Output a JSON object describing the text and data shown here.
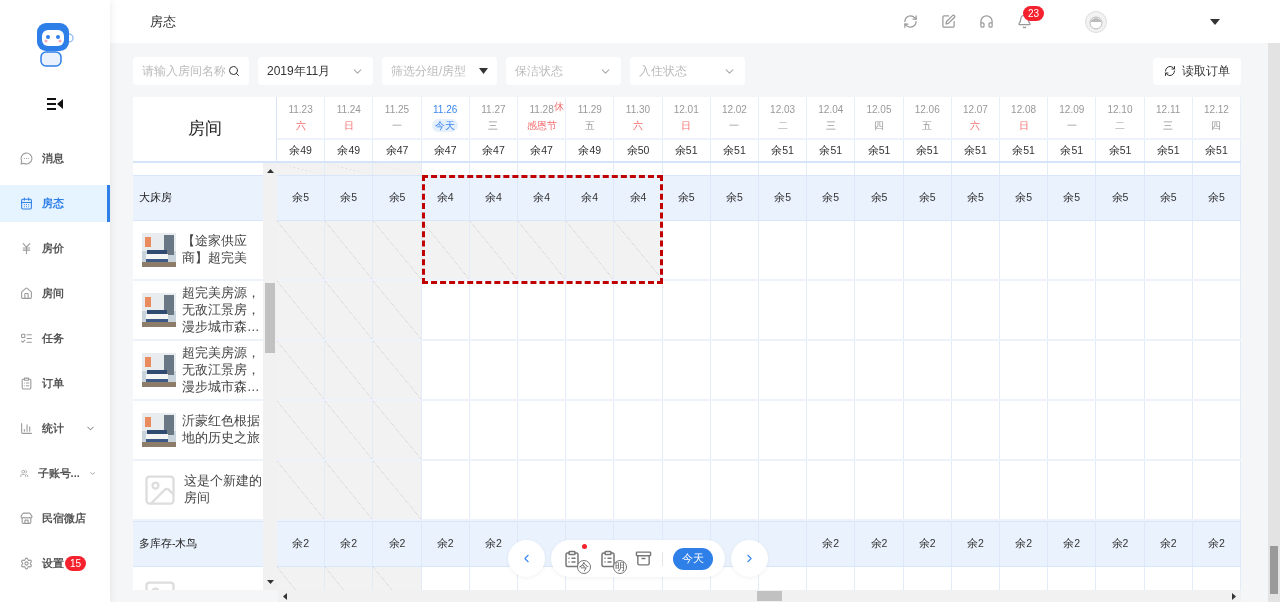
{
  "nav": [
    {
      "label": "消息",
      "selected": false
    },
    {
      "label": "房态",
      "selected": true
    },
    {
      "label": "房价",
      "selected": false
    },
    {
      "label": "房间",
      "selected": false
    },
    {
      "label": "任务",
      "selected": false
    },
    {
      "label": "订单",
      "selected": false
    },
    {
      "label": "统计",
      "selected": false,
      "expandable": true
    },
    {
      "label": "子账号...",
      "selected": false,
      "expandable": true
    },
    {
      "label": "民宿微店",
      "selected": false
    },
    {
      "label": "设置",
      "selected": false,
      "badge": "15"
    }
  ],
  "header": {
    "title": "房态",
    "notification_badge": "23"
  },
  "filters": {
    "search": {
      "placeholder": "请输入房间名称"
    },
    "month": {
      "value": "2019年11月"
    },
    "selects": [
      {
        "placeholder": "筛选分组/房型",
        "kind": "solid"
      },
      {
        "placeholder": "保洁状态",
        "kind": "chevron"
      },
      {
        "placeholder": "入住状态",
        "kind": "chevron"
      }
    ],
    "read_orders_button": "读取订单"
  },
  "table": {
    "room_column": "房间",
    "days": [
      {
        "date": "11.23",
        "label": "六",
        "kind": "weekend",
        "remaining": "余49",
        "past": true,
        "selected": false
      },
      {
        "date": "11.24",
        "label": "日",
        "kind": "weekend",
        "remaining": "余49",
        "past": true,
        "selected": false
      },
      {
        "date": "11.25",
        "label": "一",
        "kind": "weekday",
        "remaining": "余47",
        "past": true,
        "selected": false
      },
      {
        "date": "11.26",
        "label": "今天",
        "kind": "today",
        "remaining": "余47",
        "past": false,
        "selected": true
      },
      {
        "date": "11.27",
        "label": "三",
        "kind": "weekday",
        "remaining": "余47",
        "past": false,
        "selected": true
      },
      {
        "date": "11.28",
        "label": "感恩节",
        "kind": "holiday",
        "badge": "休",
        "remaining": "余47",
        "past": false,
        "selected": true
      },
      {
        "date": "11.29",
        "label": "五",
        "kind": "weekday",
        "remaining": "余49",
        "past": false,
        "selected": true
      },
      {
        "date": "11.30",
        "label": "六",
        "kind": "weekend",
        "remaining": "余50",
        "past": false,
        "selected": true
      },
      {
        "date": "12.01",
        "label": "日",
        "kind": "weekend",
        "remaining": "余51",
        "past": false,
        "selected": false
      },
      {
        "date": "12.02",
        "label": "一",
        "kind": "weekday",
        "remaining": "余51",
        "past": false,
        "selected": false
      },
      {
        "date": "12.03",
        "label": "二",
        "kind": "weekday",
        "remaining": "余51",
        "past": false,
        "selected": false
      },
      {
        "date": "12.04",
        "label": "三",
        "kind": "weekday",
        "remaining": "余51",
        "past": false,
        "selected": false
      },
      {
        "date": "12.05",
        "label": "四",
        "kind": "weekday",
        "remaining": "余51",
        "past": false,
        "selected": false
      },
      {
        "date": "12.06",
        "label": "五",
        "kind": "weekday",
        "remaining": "余51",
        "past": false,
        "selected": false
      },
      {
        "date": "12.07",
        "label": "六",
        "kind": "weekend",
        "remaining": "余51",
        "past": false,
        "selected": false
      },
      {
        "date": "12.08",
        "label": "日",
        "kind": "weekend",
        "remaining": "余51",
        "past": false,
        "selected": false
      },
      {
        "date": "12.09",
        "label": "一",
        "kind": "weekday",
        "remaining": "余51",
        "past": false,
        "selected": false
      },
      {
        "date": "12.10",
        "label": "二",
        "kind": "weekday",
        "remaining": "余51",
        "past": false,
        "selected": false
      },
      {
        "date": "12.11",
        "label": "三",
        "kind": "weekday",
        "remaining": "余51",
        "past": false,
        "selected": false
      },
      {
        "date": "12.12",
        "label": "四",
        "kind": "weekday",
        "remaining": "余51",
        "past": false,
        "selected": false
      }
    ],
    "rows": [
      {
        "kind": "group",
        "name": "大床房",
        "counts": [
          {
            "text": "余5"
          },
          {
            "text": "余5"
          },
          {
            "text": "余5"
          },
          {
            "text": "余4"
          },
          {
            "text": "余4"
          },
          {
            "text": "余4"
          },
          {
            "text": "余4"
          },
          {
            "text": "余4"
          },
          {
            "text": "余5"
          },
          {
            "text": "余5"
          },
          {
            "text": "余5"
          },
          {
            "text": "余5"
          },
          {
            "text": "余5"
          },
          {
            "text": "余5"
          },
          {
            "text": "余5"
          },
          {
            "text": "余5"
          },
          {
            "text": "余5"
          },
          {
            "text": "余5"
          },
          {
            "text": "余5"
          },
          {
            "text": "余5"
          }
        ]
      },
      {
        "kind": "room",
        "name": "【途家供应商】超完美",
        "selected": true
      },
      {
        "kind": "room",
        "name": "超完美房源，无敌江景房，漫步城市森…",
        "selected": false
      },
      {
        "kind": "room",
        "name": "超完美房源，无敌江景房，漫步城市森…",
        "selected": false
      },
      {
        "kind": "room",
        "name": "沂蒙红色根据地的历史之旅",
        "selected": false
      },
      {
        "kind": "new_room",
        "name": "这是个新建的房间",
        "selected": false
      },
      {
        "kind": "group",
        "name": "多库存-木鸟",
        "counts": [
          {
            "text": "余2"
          },
          {
            "text": "余2"
          },
          {
            "text": "余2"
          },
          {
            "text": "余2"
          },
          {
            "text": "余2"
          },
          {
            "covered": true
          },
          {
            "covered": true
          },
          {
            "covered": true
          },
          {
            "covered": true
          },
          {
            "covered": true
          },
          {
            "covered": true
          },
          {
            "text": "余2"
          },
          {
            "text": "余2"
          },
          {
            "text": "余2"
          },
          {
            "text": "余2"
          },
          {
            "text": "余2"
          },
          {
            "text": "余2"
          },
          {
            "text": "余2"
          },
          {
            "text": "余2"
          },
          {
            "text": "余2"
          }
        ]
      },
      {
        "kind": "new_room",
        "selected": false
      }
    ]
  },
  "toolbar": {
    "today_icon_text": "今",
    "tomorrow_icon_text": "明",
    "unread": true,
    "today_button": "今天"
  }
}
